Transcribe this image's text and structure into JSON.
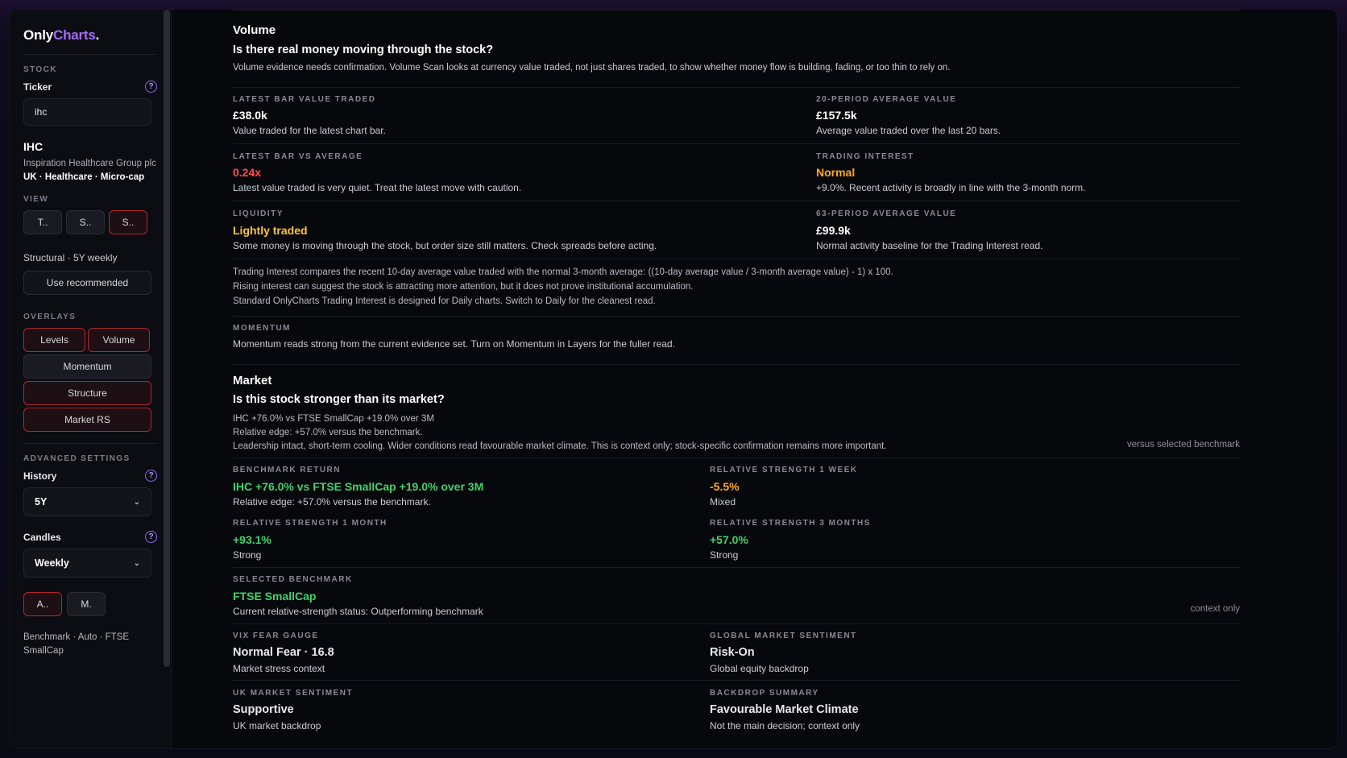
{
  "sidebar": {
    "logo_main": "Only",
    "logo_accent": "Charts",
    "logo_dot": ".",
    "stock_label": "STOCK",
    "ticker_label": "Ticker",
    "help_glyph": "?",
    "ticker_value": "ihc",
    "ticker_symbol": "IHC",
    "company_name": "Inspiration Healthcare Group plc",
    "tags": "UK · Healthcare · Micro-cap",
    "view_label": "VIEW",
    "view_buttons": [
      "T..",
      "S..",
      "S.."
    ],
    "structural_text": "Structural · 5Y weekly",
    "use_recommended": "Use recommended",
    "overlays_label": "OVERLAYS",
    "overlay_levels": "Levels",
    "overlay_volume": "Volume",
    "overlay_momentum": "Momentum",
    "overlay_structure": "Structure",
    "overlay_market_rs": "Market RS",
    "advanced_label": "ADVANCED SETTINGS",
    "history_label": "History",
    "history_value": "5Y",
    "candles_label": "Candles",
    "candles_value": "Weekly",
    "am_buttons": [
      "A..",
      "M."
    ],
    "benchmark_text": "Benchmark · Auto · FTSE SmallCap",
    "chevron_glyph": "⌄"
  },
  "volume": {
    "title": "Volume",
    "question": "Is there real money moving through the stock?",
    "description": "Volume evidence needs confirmation. Volume Scan looks at currency value traded, not just shares traded, to show whether money flow is building, fading, or too thin to rely on.",
    "latest_bar_label": "LATEST BAR VALUE TRADED",
    "latest_bar_value": "£38.0k",
    "latest_bar_sub": "Value traded for the latest chart bar.",
    "avg20_label": "20-PERIOD AVERAGE VALUE",
    "avg20_value": "£157.5k",
    "avg20_sub": "Average value traded over the last 20 bars.",
    "vs_avg_label": "LATEST BAR VS AVERAGE",
    "vs_avg_value": "0.24x",
    "vs_avg_sub": "Latest value traded is very quiet. Treat the latest move with caution.",
    "interest_label": "TRADING INTEREST",
    "interest_value": "Normal",
    "interest_sub": "+9.0%. Recent activity is broadly in line with the 3-month norm.",
    "liquidity_label": "LIQUIDITY",
    "liquidity_value": "Lightly traded",
    "liquidity_sub": "Some money is moving through the stock, but order size still matters. Check spreads before acting.",
    "avg63_label": "63-PERIOD AVERAGE VALUE",
    "avg63_value": "£99.9k",
    "avg63_sub": "Normal activity baseline for the Trading Interest read.",
    "note_1": "Trading Interest compares the recent 10-day average value traded with the normal 3-month average: ((10-day average value / 3-month average value) - 1) x 100.",
    "note_2": "Rising interest can suggest the stock is attracting more attention, but it does not prove institutional accumulation.",
    "note_3": "Standard OnlyCharts Trading Interest is designed for Daily charts. Switch to Daily for the cleanest read.",
    "momentum_label": "MOMENTUM",
    "momentum_text": "Momentum reads strong from the current evidence set. Turn on Momentum in Layers for the fuller read."
  },
  "market": {
    "title": "Market",
    "question": "Is this stock stronger than its market?",
    "line_1": "IHC +76.0% vs FTSE SmallCap +19.0% over 3M",
    "line_2": "Relative edge: +57.0% versus the benchmark.",
    "line_3": "Leadership intact, short-term cooling. Wider conditions read favourable market climate. This is context only; stock-specific confirmation remains more important.",
    "versus_note": "versus selected benchmark",
    "bench_return_label": "BENCHMARK RETURN",
    "bench_return_value": "IHC +76.0% vs FTSE SmallCap +19.0% over 3M",
    "bench_return_sub": "Relative edge: +57.0% versus the benchmark.",
    "rs1w_label": "RELATIVE STRENGTH 1 WEEK",
    "rs1w_value": "-5.5%",
    "rs1w_sub": "Mixed",
    "rs1m_label": "RELATIVE STRENGTH 1 MONTH",
    "rs1m_value": "+93.1%",
    "rs1m_sub": "Strong",
    "rs3m_label": "RELATIVE STRENGTH 3 MONTHS",
    "rs3m_value": "+57.0%",
    "rs3m_sub": "Strong",
    "selected_label": "SELECTED BENCHMARK",
    "selected_value": "FTSE SmallCap",
    "selected_sub": "Current relative-strength status: Outperforming benchmark",
    "context_note": "context only",
    "vix_label": "VIX FEAR GAUGE",
    "vix_value": "Normal Fear · 16.8",
    "vix_sub": "Market stress context",
    "global_label": "GLOBAL MARKET SENTIMENT",
    "global_value": "Risk-On",
    "global_sub": "Global equity backdrop",
    "uk_label": "UK MARKET SENTIMENT",
    "uk_value": "Supportive",
    "uk_sub": "UK market backdrop",
    "backdrop_label": "BACKDROP SUMMARY",
    "backdrop_value": "Favourable Market Climate",
    "backdrop_sub": "Not the main decision; context only"
  },
  "colors": {
    "accent": "#a56bff",
    "red": "#ff4b55",
    "orange": "#ffaa1e",
    "yellow": "#ffc62b",
    "green": "#3ed36a"
  }
}
